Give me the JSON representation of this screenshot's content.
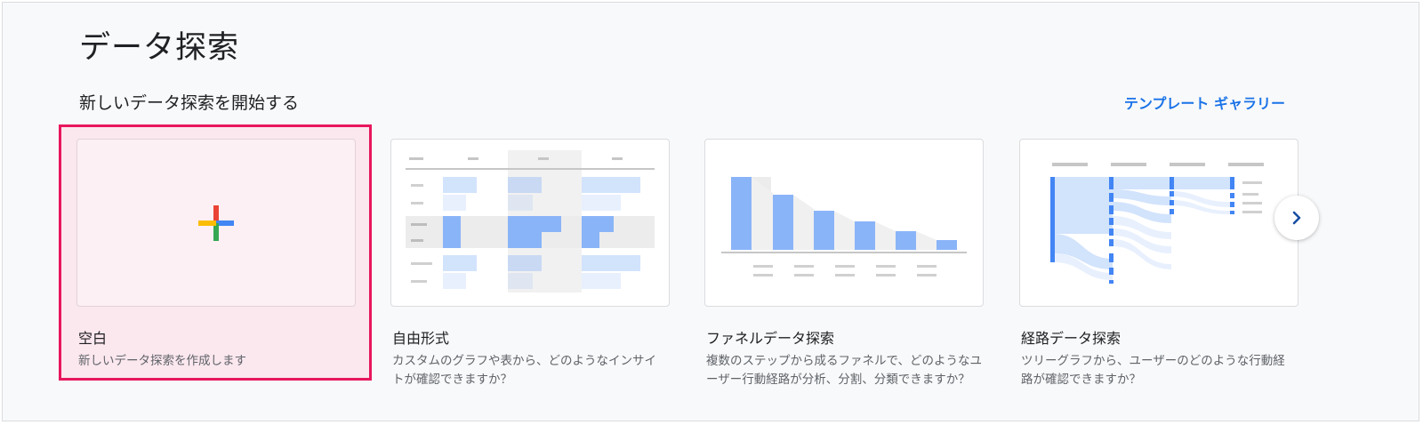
{
  "header": {
    "title": "データ探索"
  },
  "section": {
    "title": "新しいデータ探索を開始する",
    "gallery_link": "テンプレート ギャラリー"
  },
  "cards": [
    {
      "title": "空白",
      "description": "新しいデータ探索を作成します",
      "icon": "plus-icon"
    },
    {
      "title": "自由形式",
      "description": "カスタムのグラフや表から、どのようなインサイトが確認できますか？",
      "icon": "free-form-thumbnail"
    },
    {
      "title": "ファネルデータ探索",
      "description": "複数のステップから成るファネルで、どのようなユーザー行動経路が分析、分割、分類できますか？",
      "icon": "funnel-thumbnail"
    },
    {
      "title": "経路データ探索",
      "description": "ツリーグラフから、ユーザーのどのような行動経路が確認できますか？",
      "icon": "path-thumbnail"
    }
  ],
  "navigation": {
    "next_icon": "chevron-right-icon"
  },
  "colors": {
    "accent": "#1a73e8",
    "highlight_border": "#e8175d",
    "bar_blue": "#8ab4f8",
    "light_blue": "#d2e3fc"
  }
}
